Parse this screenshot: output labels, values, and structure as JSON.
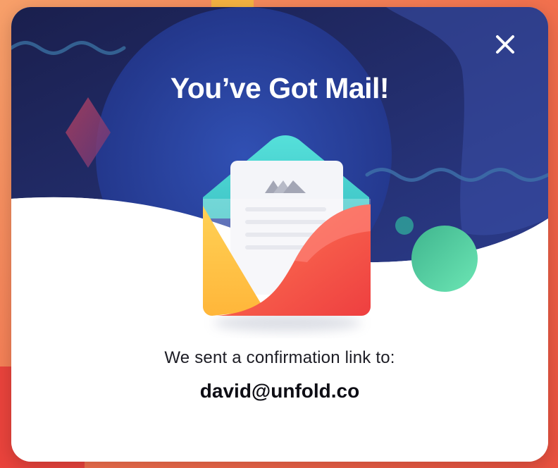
{
  "dialog": {
    "title": "You’ve Got Mail!",
    "message": "We sent a confirmation link to:",
    "email": "david@unfold.co",
    "close_icon": "close-icon",
    "illustration_icon": "open-envelope-icon"
  },
  "colors": {
    "header_dark": "#1e2456",
    "header_blue": "#2c49a3",
    "body_bg": "#ffffff",
    "accent_red": "#f04b3f",
    "accent_yellow": "#ffc84a",
    "accent_teal": "#4fd6d1",
    "accent_green": "#4bd1a0",
    "backdrop_orange": "#f2734f"
  }
}
